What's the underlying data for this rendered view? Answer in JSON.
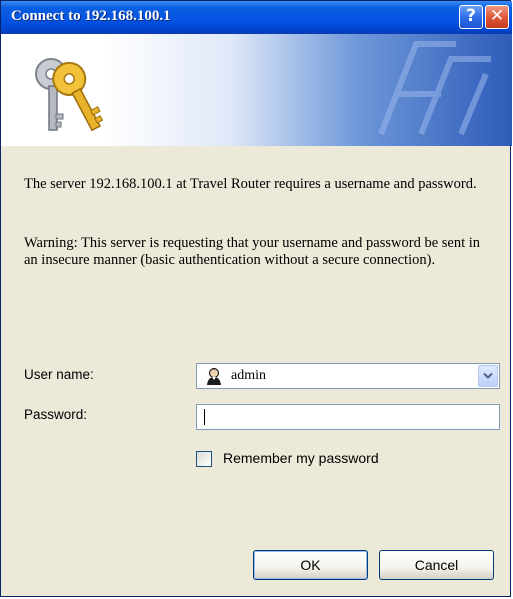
{
  "window": {
    "title": "Connect to 192.168.100.1",
    "help_glyph": "?",
    "close_glyph": "✕"
  },
  "banner": {
    "icon": "keys-icon"
  },
  "message": {
    "line1": "The server 192.168.100.1 at Travel Router requires a username and password.",
    "warning": "Warning: This server is requesting that your username and password be sent in an insecure manner (basic authentication without a secure connection)."
  },
  "form": {
    "username_label": "User name:",
    "username_value": "admin",
    "password_label": "Password:",
    "password_value": "",
    "remember_label": "Remember my password",
    "remember_checked": false
  },
  "buttons": {
    "ok": "OK",
    "cancel": "Cancel"
  },
  "colors": {
    "titlebar": "#0054e3",
    "dialog_bg": "#ece9d8",
    "close_button": "#e0583a"
  }
}
